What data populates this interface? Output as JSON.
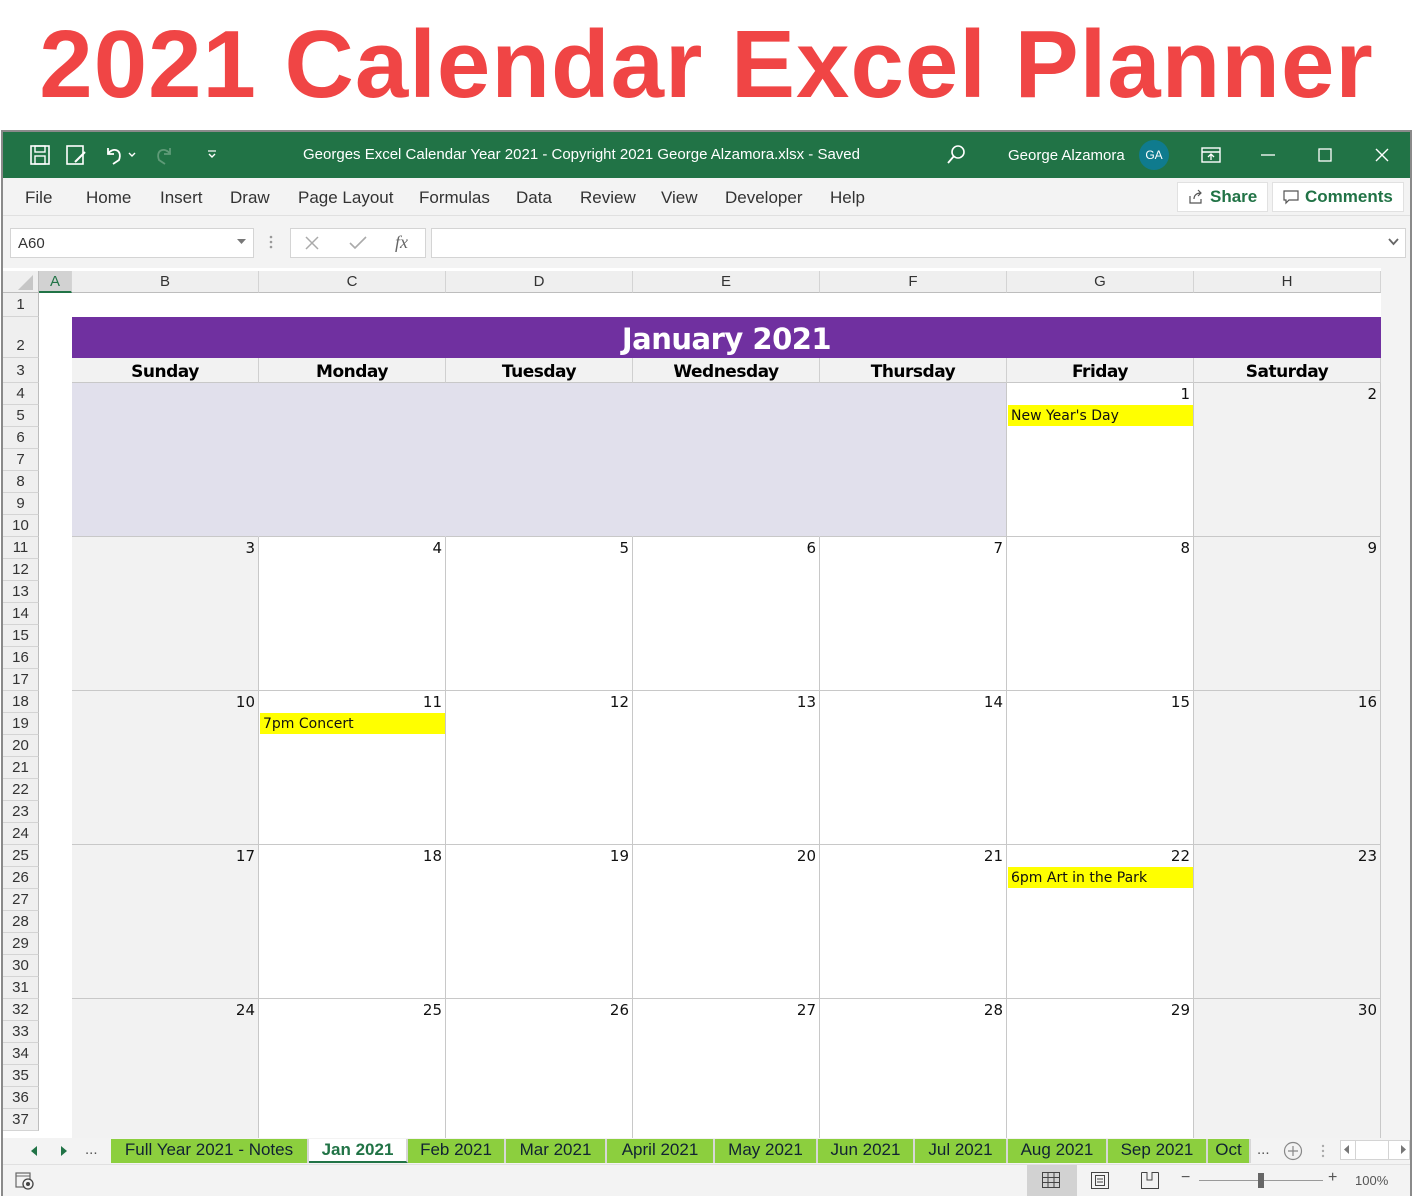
{
  "banner": {
    "title": "2021 Calendar Excel Planner"
  },
  "window": {
    "title": "Georges Excel Calendar Year 2021 - Copyright 2021 George Alzamora.xlsx  -  Saved",
    "user_name": "George Alzamora",
    "avatar_initials": "GA",
    "accent": "#217346"
  },
  "ribbon": {
    "menus": [
      "File",
      "Home",
      "Insert",
      "Draw",
      "Page Layout",
      "Formulas",
      "Data",
      "Review",
      "View",
      "Developer",
      "Help"
    ],
    "share_label": "Share",
    "comments_label": "Comments"
  },
  "formula_bar": {
    "name_box": "A60",
    "fx_label": "fx",
    "formula": ""
  },
  "columns": [
    "A",
    "B",
    "C",
    "D",
    "E",
    "F",
    "G",
    "H"
  ],
  "rows": [
    "1",
    "2",
    "3",
    "4",
    "5",
    "6",
    "7",
    "8",
    "9",
    "10",
    "11",
    "12",
    "13",
    "14",
    "15",
    "16",
    "17",
    "18",
    "19",
    "20",
    "21",
    "22",
    "23",
    "24",
    "25",
    "26",
    "27",
    "28",
    "29",
    "30",
    "31",
    "32",
    "33",
    "34",
    "35",
    "36",
    "37"
  ],
  "calendar": {
    "month_title": "January 2021",
    "header_color": "#7030a0",
    "day_names": [
      "Sunday",
      "Monday",
      "Tuesday",
      "Wednesday",
      "Thursday",
      "Friday",
      "Saturday"
    ],
    "weeks": [
      [
        {
          "d": ""
        },
        {
          "d": ""
        },
        {
          "d": ""
        },
        {
          "d": ""
        },
        {
          "d": ""
        },
        {
          "d": "1",
          "event": "New Year's Day"
        },
        {
          "d": "2"
        }
      ],
      [
        {
          "d": "3"
        },
        {
          "d": "4"
        },
        {
          "d": "5"
        },
        {
          "d": "6"
        },
        {
          "d": "7"
        },
        {
          "d": "8"
        },
        {
          "d": "9"
        }
      ],
      [
        {
          "d": "10"
        },
        {
          "d": "11",
          "event": "7pm Concert"
        },
        {
          "d": "12"
        },
        {
          "d": "13"
        },
        {
          "d": "14"
        },
        {
          "d": "15"
        },
        {
          "d": "16"
        }
      ],
      [
        {
          "d": "17"
        },
        {
          "d": "18"
        },
        {
          "d": "19"
        },
        {
          "d": "20"
        },
        {
          "d": "21"
        },
        {
          "d": "22",
          "event": "6pm Art in the Park"
        },
        {
          "d": "23"
        }
      ],
      [
        {
          "d": "24"
        },
        {
          "d": "25"
        },
        {
          "d": "26"
        },
        {
          "d": "27"
        },
        {
          "d": "28"
        },
        {
          "d": "29"
        },
        {
          "d": "30"
        }
      ]
    ]
  },
  "sheet_tabs": {
    "overflow_label": "...",
    "tabs": [
      "Full Year 2021 - Notes",
      "Jan 2021",
      "Feb 2021",
      "Mar 2021",
      "April 2021",
      "May 2021",
      "Jun 2021",
      "Jul 2021",
      "Aug 2021",
      "Sep 2021",
      "Oct"
    ],
    "active_index": 1,
    "more_label": "..."
  },
  "status_bar": {
    "zoom": "100%",
    "zoom_minus": "−",
    "zoom_plus": "+"
  }
}
